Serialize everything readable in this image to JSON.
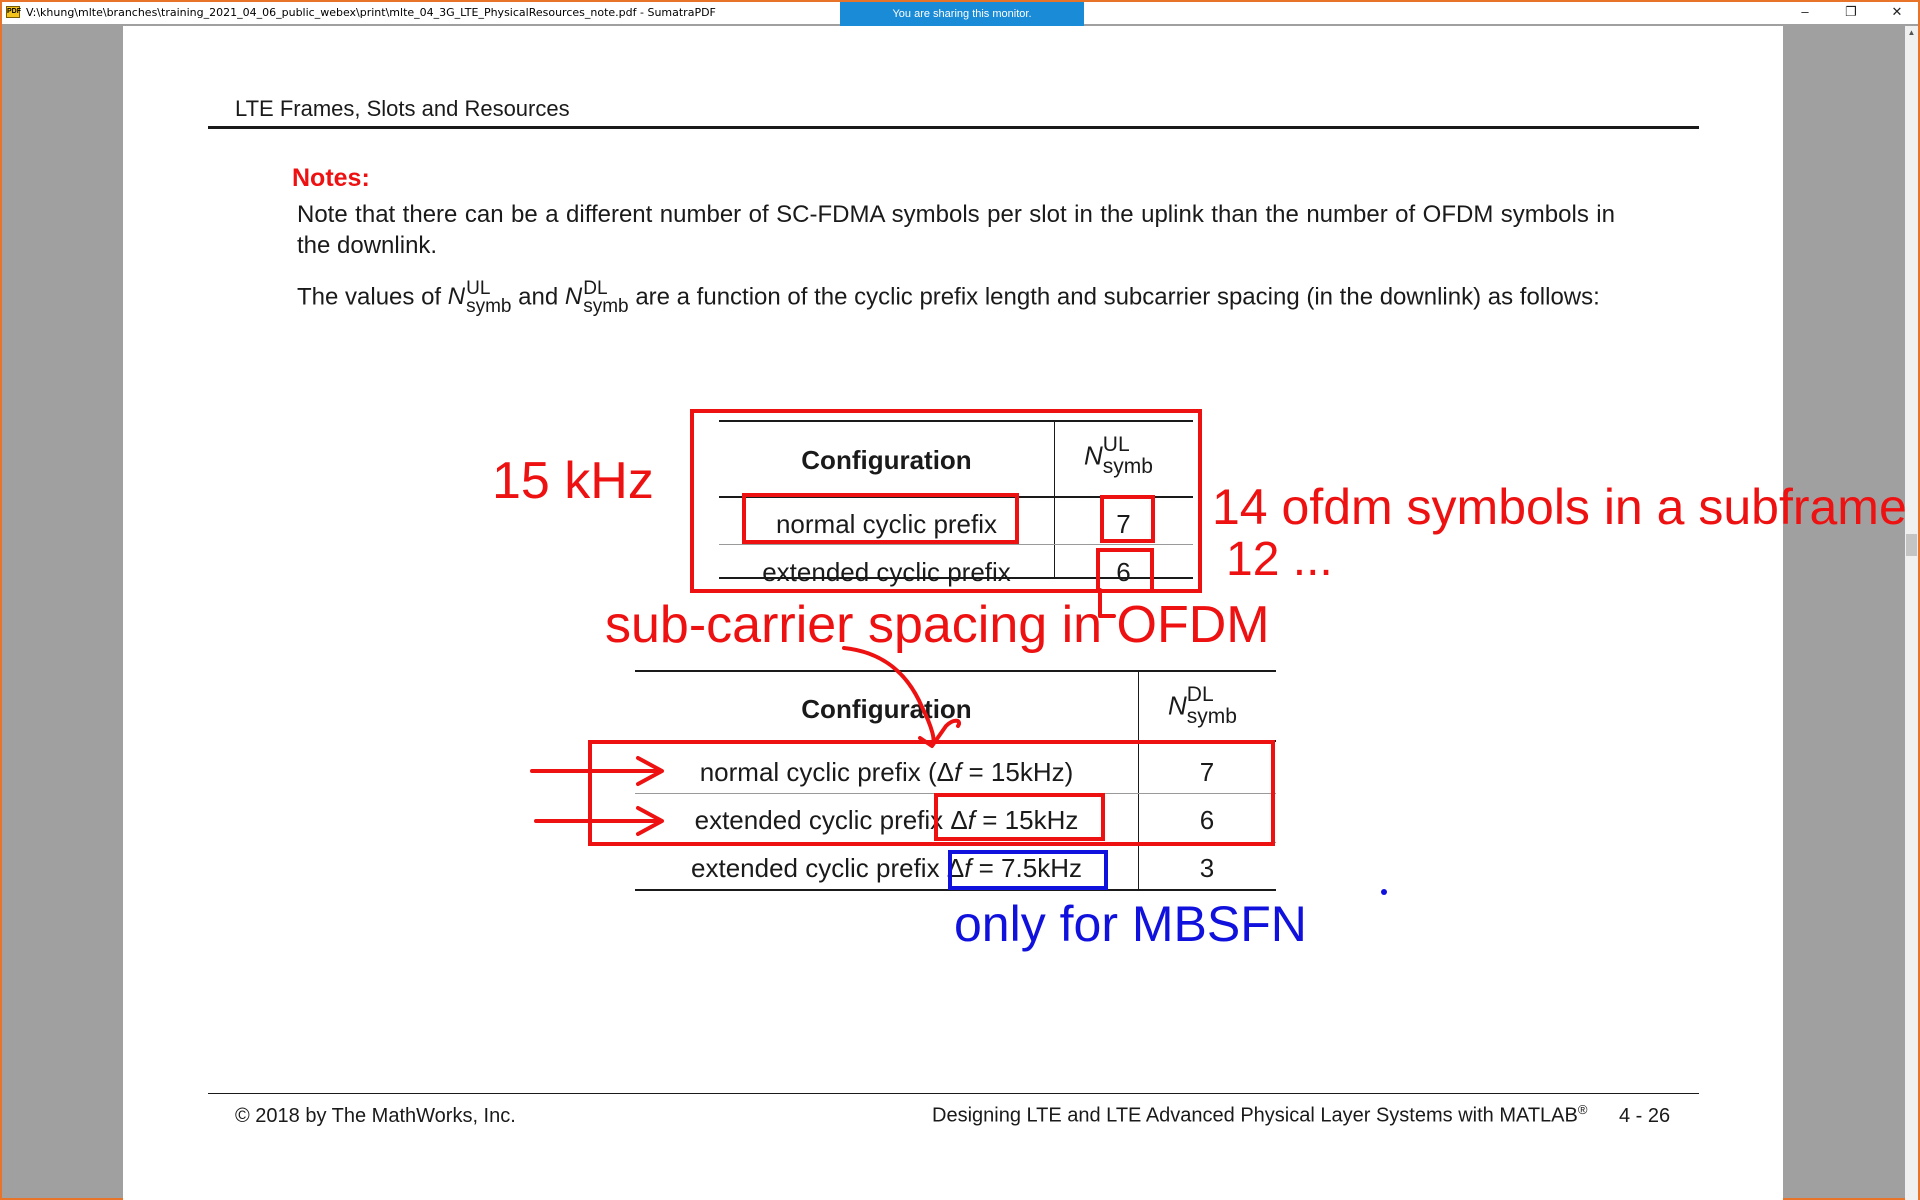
{
  "window": {
    "app_icon_text": "PDF",
    "title": "V:\\khung\\mlte\\branches\\training_2021_04_06_public_webex\\print\\mlte_04_3G_LTE_PhysicalResources_note.pdf - SumatraPDF",
    "sharing_banner": "You are sharing this monitor.",
    "minimize_glyph": "–",
    "maximize_glyph": "❐",
    "close_glyph": "✕",
    "scroll_up_glyph": "▲"
  },
  "document": {
    "header": "LTE Frames, Slots and Resources",
    "notes_label": "Notes:",
    "paragraph1": "Note that there can be a different number of SC-FDMA symbols per slot in the uplink than the number of OFDM symbols in the downlink.",
    "paragraph2": {
      "prefix": "The values of ",
      "symbol1": {
        "base": "N",
        "sup": "UL",
        "sub": "symb"
      },
      "middle": " and ",
      "symbol2": {
        "base": "N",
        "sup": "DL",
        "sub": "symb"
      },
      "suffix": " are a function of the cyclic prefix length and subcarrier spacing (in the downlink) as follows:"
    },
    "ul_table": {
      "col1_header": "Configuration",
      "col2_header": {
        "base": "N",
        "sup": "UL",
        "sub": "symb"
      },
      "rows": [
        {
          "config": "normal cyclic prefix",
          "value": "7"
        },
        {
          "config": "extended cyclic prefix",
          "value": "6"
        }
      ]
    },
    "dl_table": {
      "col1_header": "Configuration",
      "col2_header": {
        "base": "N",
        "sup": "DL",
        "sub": "symb"
      },
      "rows": [
        {
          "config_text": "normal cyclic prefix (",
          "delta": "Δ",
          "f": "f",
          "eq": " = 15kHz)",
          "value": "7"
        },
        {
          "config_text": "extended cyclic prefix ",
          "delta": "Δ",
          "f": "f",
          "eq": " = 15kHz",
          "value": "6"
        },
        {
          "config_text": "extended cyclic prefix ",
          "delta": "Δ",
          "f": "f",
          "eq": " = 7.5kHz",
          "value": "3"
        }
      ]
    },
    "footer": {
      "copyright": "© 2018 by The MathWorks, Inc.",
      "title": "Designing LTE and LTE Advanced Physical Layer Systems with MATLAB",
      "title_mark": "®",
      "page": "4 - 26"
    }
  },
  "annotations": {
    "red_color": "#ee1111",
    "blue_color": "#1111dd",
    "khz_15": "15 kHz",
    "ofdm_symbols": "14 ofdm symbols in a subframe",
    "twelve": "12 ...",
    "subcarrier": "sub-carrier spacing in OFDM",
    "mbsfn": "only for MBSFN"
  }
}
